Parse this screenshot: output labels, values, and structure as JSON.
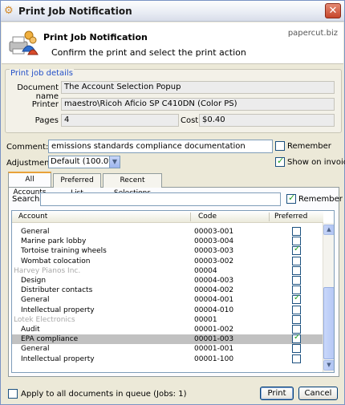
{
  "window": {
    "title": "Print Job Notification"
  },
  "header": {
    "title": "Print Job Notification",
    "subtitle": "Confirm the print and select the print action",
    "link": "papercut.biz"
  },
  "details": {
    "group_label": "Print job details",
    "document_name_label": "Document name",
    "document_name": "The Account Selection Popup",
    "printer_label": "Printer",
    "printer": "maestro\\Ricoh Aficio SP C410DN (Color PS)",
    "pages_label": "Pages",
    "pages": "4",
    "cost_label": "Cost",
    "cost": "$0.40"
  },
  "comment": {
    "label": "Comment:",
    "value": "emissions standards compliance documentation",
    "remember_label": "Remember",
    "remember_checked": false
  },
  "adjustment": {
    "label": "Adjustment:",
    "value": "Default (100.0%)",
    "show_on_invoice_label": "Show on invoice",
    "show_on_invoice_checked": true
  },
  "tabs": [
    "All Accounts",
    "Preferred List",
    "Recent Selections"
  ],
  "search": {
    "label": "Search:",
    "value": "",
    "remember_label": "Remember",
    "remember_checked": true
  },
  "table": {
    "columns": [
      "Account",
      "Code",
      "Preferred"
    ],
    "rows": [
      {
        "account": "General",
        "code": "00003-001",
        "preferred": false,
        "group": false,
        "selected": false
      },
      {
        "account": "Marine park lobby",
        "code": "00003-004",
        "preferred": false,
        "group": false,
        "selected": false
      },
      {
        "account": "Tortoise training wheels",
        "code": "00003-003",
        "preferred": true,
        "group": false,
        "selected": false
      },
      {
        "account": "Wombat colocation",
        "code": "00003-002",
        "preferred": false,
        "group": false,
        "selected": false
      },
      {
        "account": "Harvey Pianos Inc.",
        "code": "00004",
        "preferred": false,
        "group": true,
        "selected": false
      },
      {
        "account": "Design",
        "code": "00004-003",
        "preferred": false,
        "group": false,
        "selected": false
      },
      {
        "account": "Distributer contacts",
        "code": "00004-002",
        "preferred": false,
        "group": false,
        "selected": false
      },
      {
        "account": "General",
        "code": "00004-001",
        "preferred": true,
        "group": false,
        "selected": false
      },
      {
        "account": "Intellectual property",
        "code": "00004-010",
        "preferred": false,
        "group": false,
        "selected": false
      },
      {
        "account": "Lotek Electronics",
        "code": "00001",
        "preferred": false,
        "group": true,
        "selected": false
      },
      {
        "account": "Audit",
        "code": "00001-002",
        "preferred": false,
        "group": false,
        "selected": false
      },
      {
        "account": "EPA compliance",
        "code": "00001-003",
        "preferred": true,
        "group": false,
        "selected": true
      },
      {
        "account": "General",
        "code": "00001-001",
        "preferred": false,
        "group": false,
        "selected": false
      },
      {
        "account": "Intellectual property",
        "code": "00001-100",
        "preferred": false,
        "group": false,
        "selected": false
      }
    ]
  },
  "footer": {
    "apply_label": "Apply to all documents in queue (Jobs: 1)",
    "apply_checked": false,
    "print_label": "Print",
    "cancel_label": "Cancel"
  },
  "icons": {
    "title": "printer-user-icon",
    "header": "users-printer-icon",
    "close": "close-icon"
  }
}
